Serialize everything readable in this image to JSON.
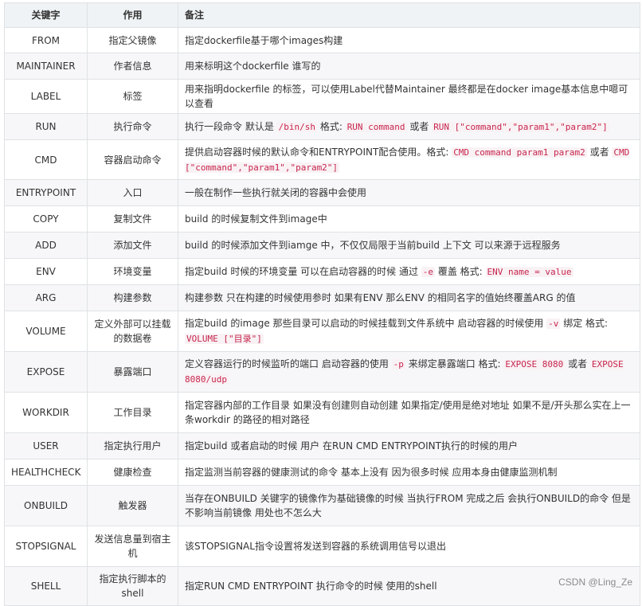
{
  "header": {
    "key": "关键字",
    "role": "作用",
    "note": "备注"
  },
  "rows": [
    {
      "key": "FROM",
      "role": "指定父镜像",
      "h": 32,
      "note": [
        {
          "t": "指定dockerfile基于哪个images构建"
        }
      ]
    },
    {
      "key": "MAINTAINER",
      "role": "作者信息",
      "h": 33,
      "note": [
        {
          "t": "用来标明这个dockerfile 谁写的"
        }
      ]
    },
    {
      "key": "LABEL",
      "role": "标签",
      "h": 33,
      "note": [
        {
          "t": "用来指明dockerfile 的标签，可以使用Label代替Maintainer 最终都是在docker image基本信息中嗯可以查看"
        }
      ]
    },
    {
      "key": "RUN",
      "role": "执行命令",
      "h": 33,
      "note": [
        {
          "t": "执行一段命令 默认是 "
        },
        {
          "c": "/bin/sh"
        },
        {
          "t": " 格式: "
        },
        {
          "c": "RUN command"
        },
        {
          "t": " 或者 "
        },
        {
          "c": "RUN [\"command\",\"param1\",\"param2\"]"
        }
      ]
    },
    {
      "key": "CMD",
      "role": "容器启动命令",
      "h": 50,
      "note": [
        {
          "t": "提供启动容器时候的默认命令和ENTRYPOINT配合使用。格式: "
        },
        {
          "c": "CMD command param1 param2"
        },
        {
          "t": " 或者 "
        },
        {
          "c": "CMD [\"command\",\"param1\",\"param2\"]"
        }
      ]
    },
    {
      "key": "ENTRYPOINT",
      "role": "入口",
      "h": 33,
      "note": [
        {
          "t": "一般在制作一些执行就关闭的容器中会使用"
        }
      ]
    },
    {
      "key": "COPY",
      "role": "复制文件",
      "h": 33,
      "note": [
        {
          "t": "build 的时候复制文件到image中"
        }
      ]
    },
    {
      "key": "ADD",
      "role": "添加文件",
      "h": 33,
      "note": [
        {
          "t": "build 的时候添加文件到iamge 中，不仅仅局限于当前build 上下文 可以来源于远程服务"
        }
      ]
    },
    {
      "key": "ENV",
      "role": "环境变量",
      "h": 33,
      "note": [
        {
          "t": "指定build 时候的环境变量 可以在启动容器的时候 通过 "
        },
        {
          "c": "-e"
        },
        {
          "t": " 覆盖 格式: "
        },
        {
          "c": "ENV name = value"
        }
      ]
    },
    {
      "key": "ARG",
      "role": "构建参数",
      "h": 33,
      "note": [
        {
          "t": "构建参数 只在构建的时候使用参时 如果有ENV 那么ENV 的相同名字的值始终覆盖ARG 的值"
        }
      ]
    },
    {
      "key": "VOLUME",
      "role": "定义外部可以挂载的数据卷",
      "h": 51,
      "note": [
        {
          "t": "指定build 的image 那些目录可以启动的时候挂载到文件系统中 启动容器的时候使用 "
        },
        {
          "c": "-v"
        },
        {
          "t": " 绑定 格式: "
        },
        {
          "c": "VOLUME [\"目录\"]"
        }
      ]
    },
    {
      "key": "EXPOSE",
      "role": "暴露端口",
      "h": 51,
      "note": [
        {
          "t": "定义容器运行的时候监听的端口 启动容器的使用 "
        },
        {
          "c": "-p"
        },
        {
          "t": " 来绑定暴露端口 格式: "
        },
        {
          "c": "EXPOSE 8080"
        },
        {
          "t": " 或者 "
        },
        {
          "c": "EXPOSE 8080/udp"
        }
      ]
    },
    {
      "key": "WORKDIR",
      "role": "工作目录",
      "h": 51,
      "note": [
        {
          "t": "指定容器内部的工作目录 如果没有创建则自动创建 如果指定/使用是绝对地址 如果不是/开头那么实在上一条workdir 的路径的相对路径"
        }
      ]
    },
    {
      "key": "USER",
      "role": "指定执行用户",
      "h": 33,
      "note": [
        {
          "t": "指定build 或者启动的时候 用户 在RUN CMD ENTRYPOINT执行的时候的用户"
        }
      ]
    },
    {
      "key": "HEALTHCHECK",
      "role": "健康检查",
      "h": 33,
      "note": [
        {
          "t": "指定监测当前容器的健康测试的命令 基本上没有 因为很多时候 应用本身由健康监测机制"
        }
      ]
    },
    {
      "key": "ONBUILD",
      "role": "触发器",
      "h": 51,
      "note": [
        {
          "t": "当存在ONBUILD 关键字的镜像作为基础镜像的时候 当执行FROM 完成之后 会执行ONBUILD的命令 但是不影响当前镜像 用处也不怎么大"
        }
      ]
    },
    {
      "key": "STOPSIGNAL",
      "role": "发送信息量到宿主机",
      "h": 51,
      "note": [
        {
          "t": "该STOPSIGNAL指令设置将发送到容器的系统调用信号以退出"
        }
      ]
    },
    {
      "key": "SHELL",
      "role": "指定执行脚本的shell",
      "h": 49,
      "note": [
        {
          "t": "指定RUN CMD ENTRYPOINT 执行命令的时候 使用的shell"
        }
      ]
    }
  ],
  "watermark": "CSDN @Ling_Ze"
}
